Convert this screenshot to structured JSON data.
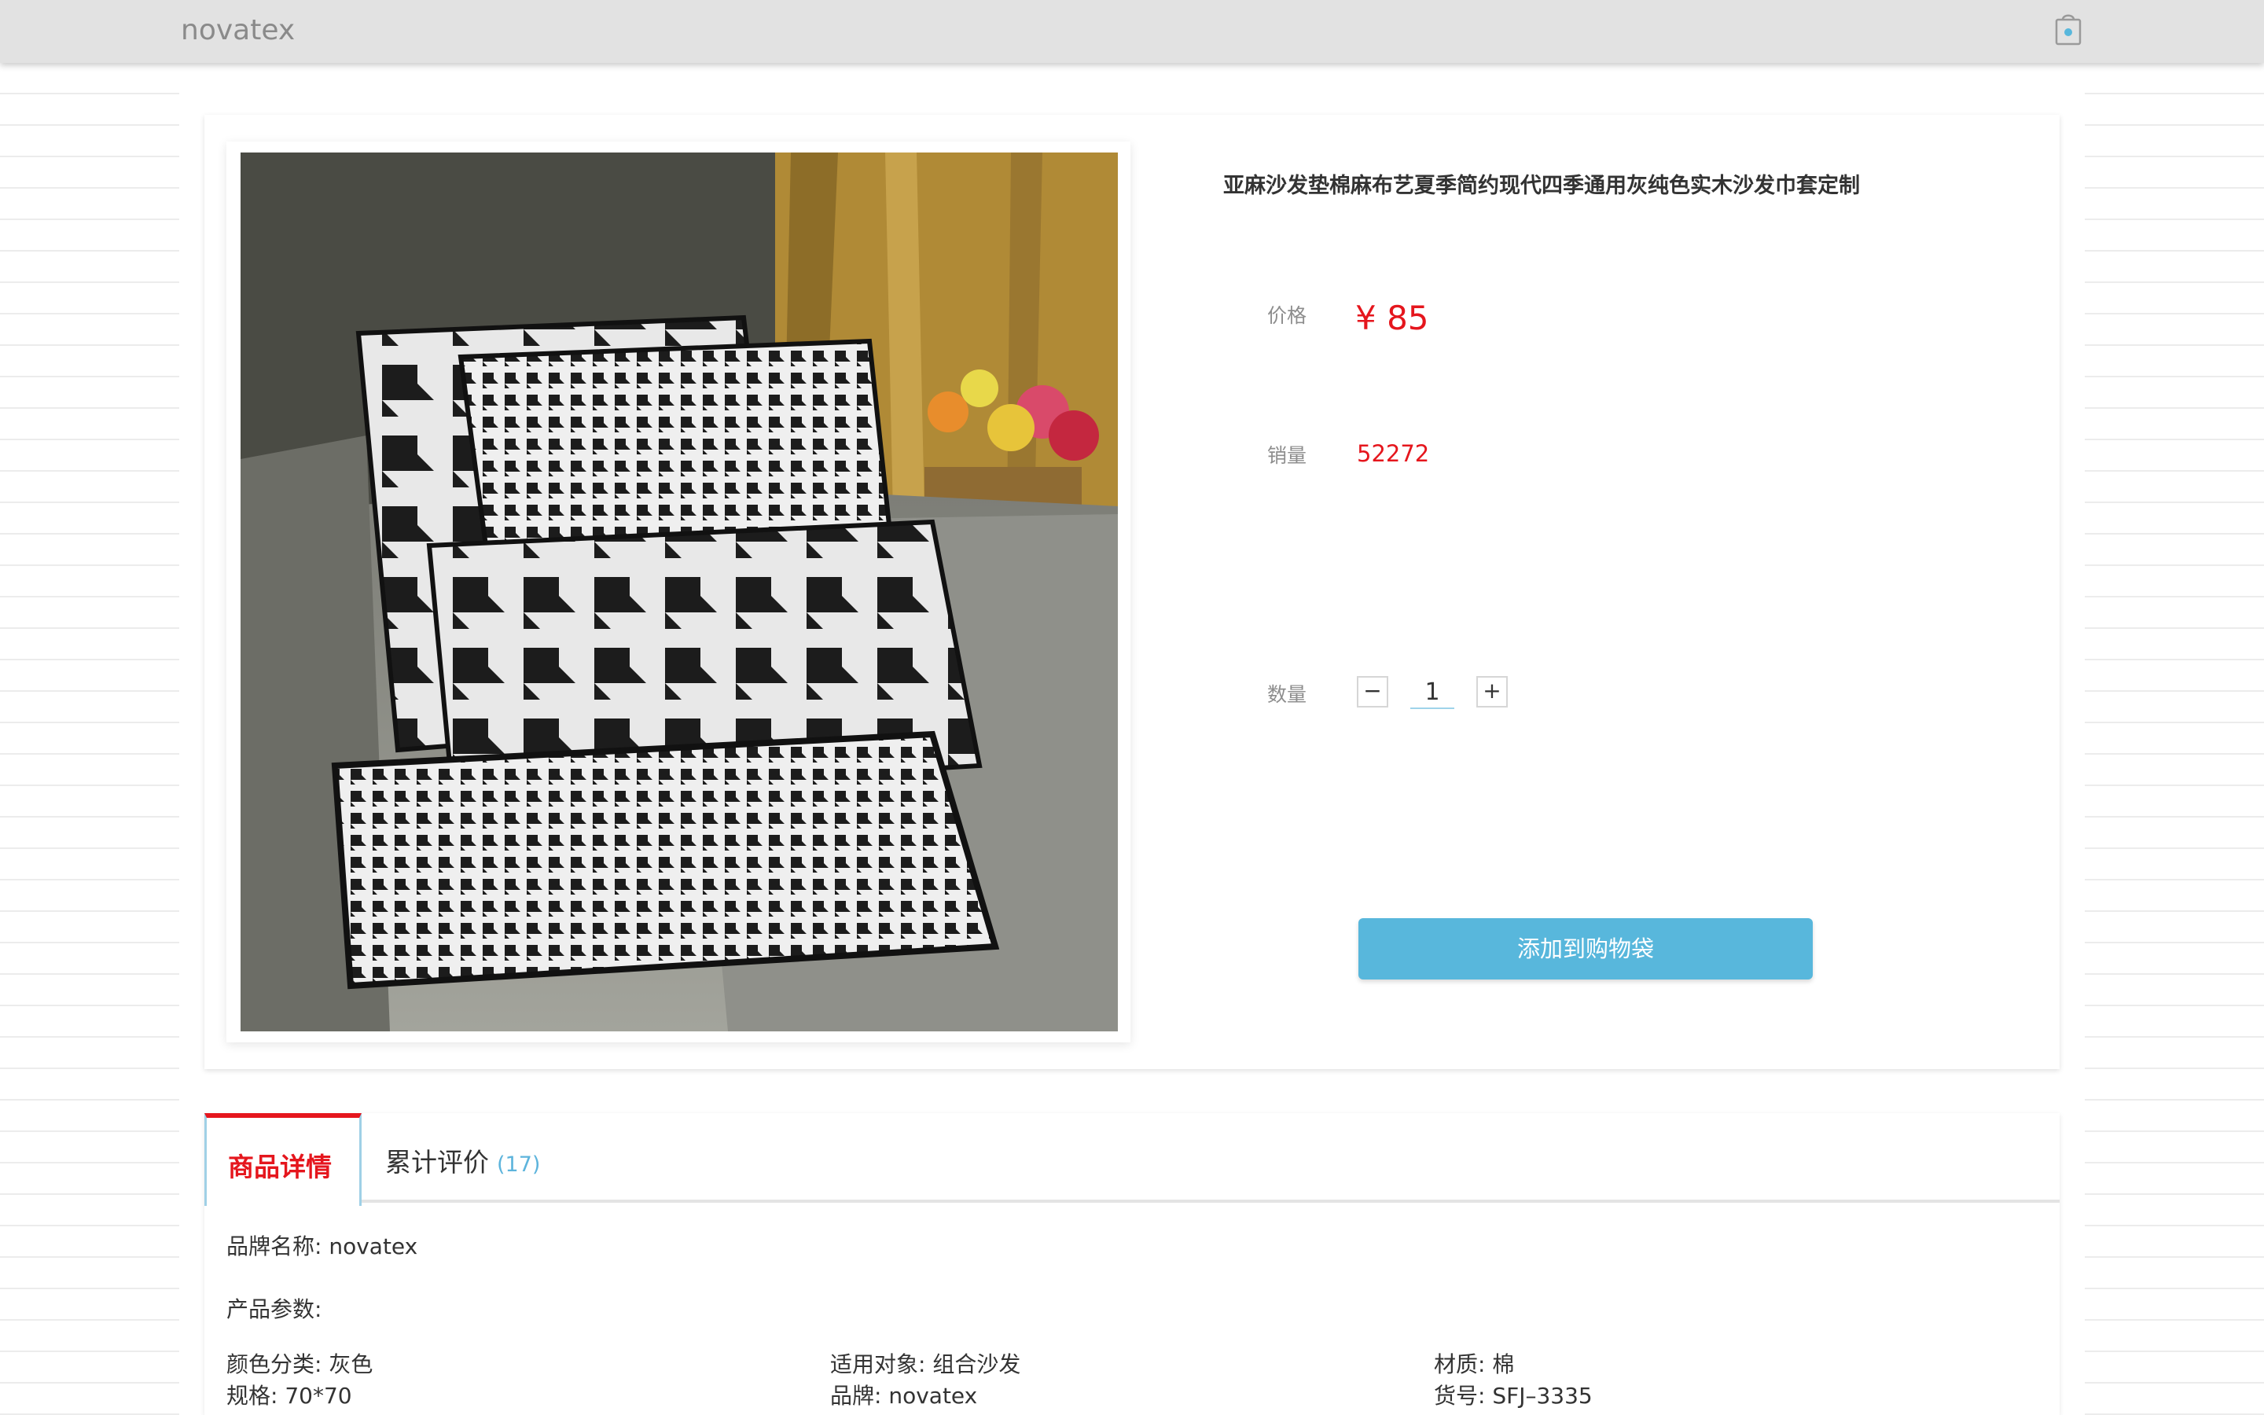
{
  "header": {
    "brand": "novatex",
    "cart_icon": "shopping-bag-icon"
  },
  "product": {
    "title": "亚麻沙发垫棉麻布艺夏季简约现代四季通用灰纯色实木沙发巾套定制",
    "price_label": "价格",
    "price": "¥ 85",
    "sales_label": "销量",
    "sales": "52272",
    "quantity_label": "数量",
    "quantity": "1",
    "minus_label": "−",
    "plus_label": "+",
    "add_to_bag": "添加到购物袋",
    "colors": {
      "price": "#e5161d",
      "button": "#58b7dc"
    }
  },
  "tabs": {
    "detail": "商品详情",
    "reviews": "累计评价",
    "reviews_count": "(17)"
  },
  "details": {
    "brand_line": "品牌名称: novatex",
    "params_title": "产品参数:",
    "specs": [
      "颜色分类: 灰色",
      "适用对象: 组合沙发",
      "材质: 棉",
      "规格: 70*70",
      "品牌: novatex",
      "货号: SFJ–3335"
    ]
  }
}
